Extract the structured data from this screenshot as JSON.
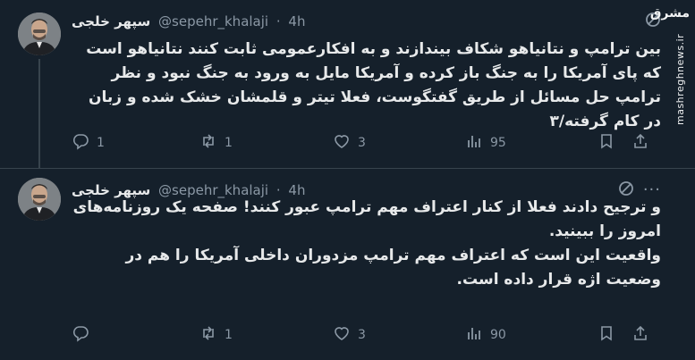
{
  "tweets": [
    {
      "display_name": "سپهر خلجی",
      "handle": "@sepehr_khalaji",
      "separator": "·",
      "time": "4h",
      "body_lines": [
        "بین ترامپ و نتانیاهو شکاف بیندازند و به افکارعمومی ثابت کنند نتانیاهو است که پای آمریکا را به جنگ باز کرده و آمریکا مایل به ورود به جنگ نبود و نظر ترامپ حل مسائل از طریق گفتگوست، فعلا تیتر و قلمشان خشک شده و زبان در کام گرفته/۳"
      ],
      "stats": {
        "replies": "1",
        "retweets": "1",
        "likes": "3",
        "views": "95"
      }
    },
    {
      "display_name": "سپهر خلجی",
      "handle": "@sepehr_khalaji",
      "separator": "·",
      "time": "4h",
      "more": "···",
      "body_lines": [
        "و ترجیح دادند فعلا از کنار اعتراف مهم ترامپ عبور کنند! صفحه یک روزنامه‌های امروز را ببینید.",
        "واقعیت این است که اعتراف مهم ترامپ مزدوران داخلی آمریکا را هم در وضعیت اژه قرار داده است."
      ],
      "stats": {
        "replies": "",
        "retweets": "1",
        "likes": "3",
        "views": "90"
      }
    }
  ],
  "watermark": {
    "logo_text": "مشرق",
    "vertical_text": "mashreghnews.ir"
  },
  "icons": {
    "reply": "reply-icon",
    "retweet": "retweet-icon",
    "like": "heart-icon",
    "views": "views-icon",
    "bookmark": "bookmark-icon",
    "share": "share-icon",
    "grok": "grok-icon",
    "more": "more-icon"
  },
  "colors": {
    "background": "#15202b",
    "text": "#e7e9ea",
    "muted": "#8b98a5",
    "divider": "#38444d"
  }
}
